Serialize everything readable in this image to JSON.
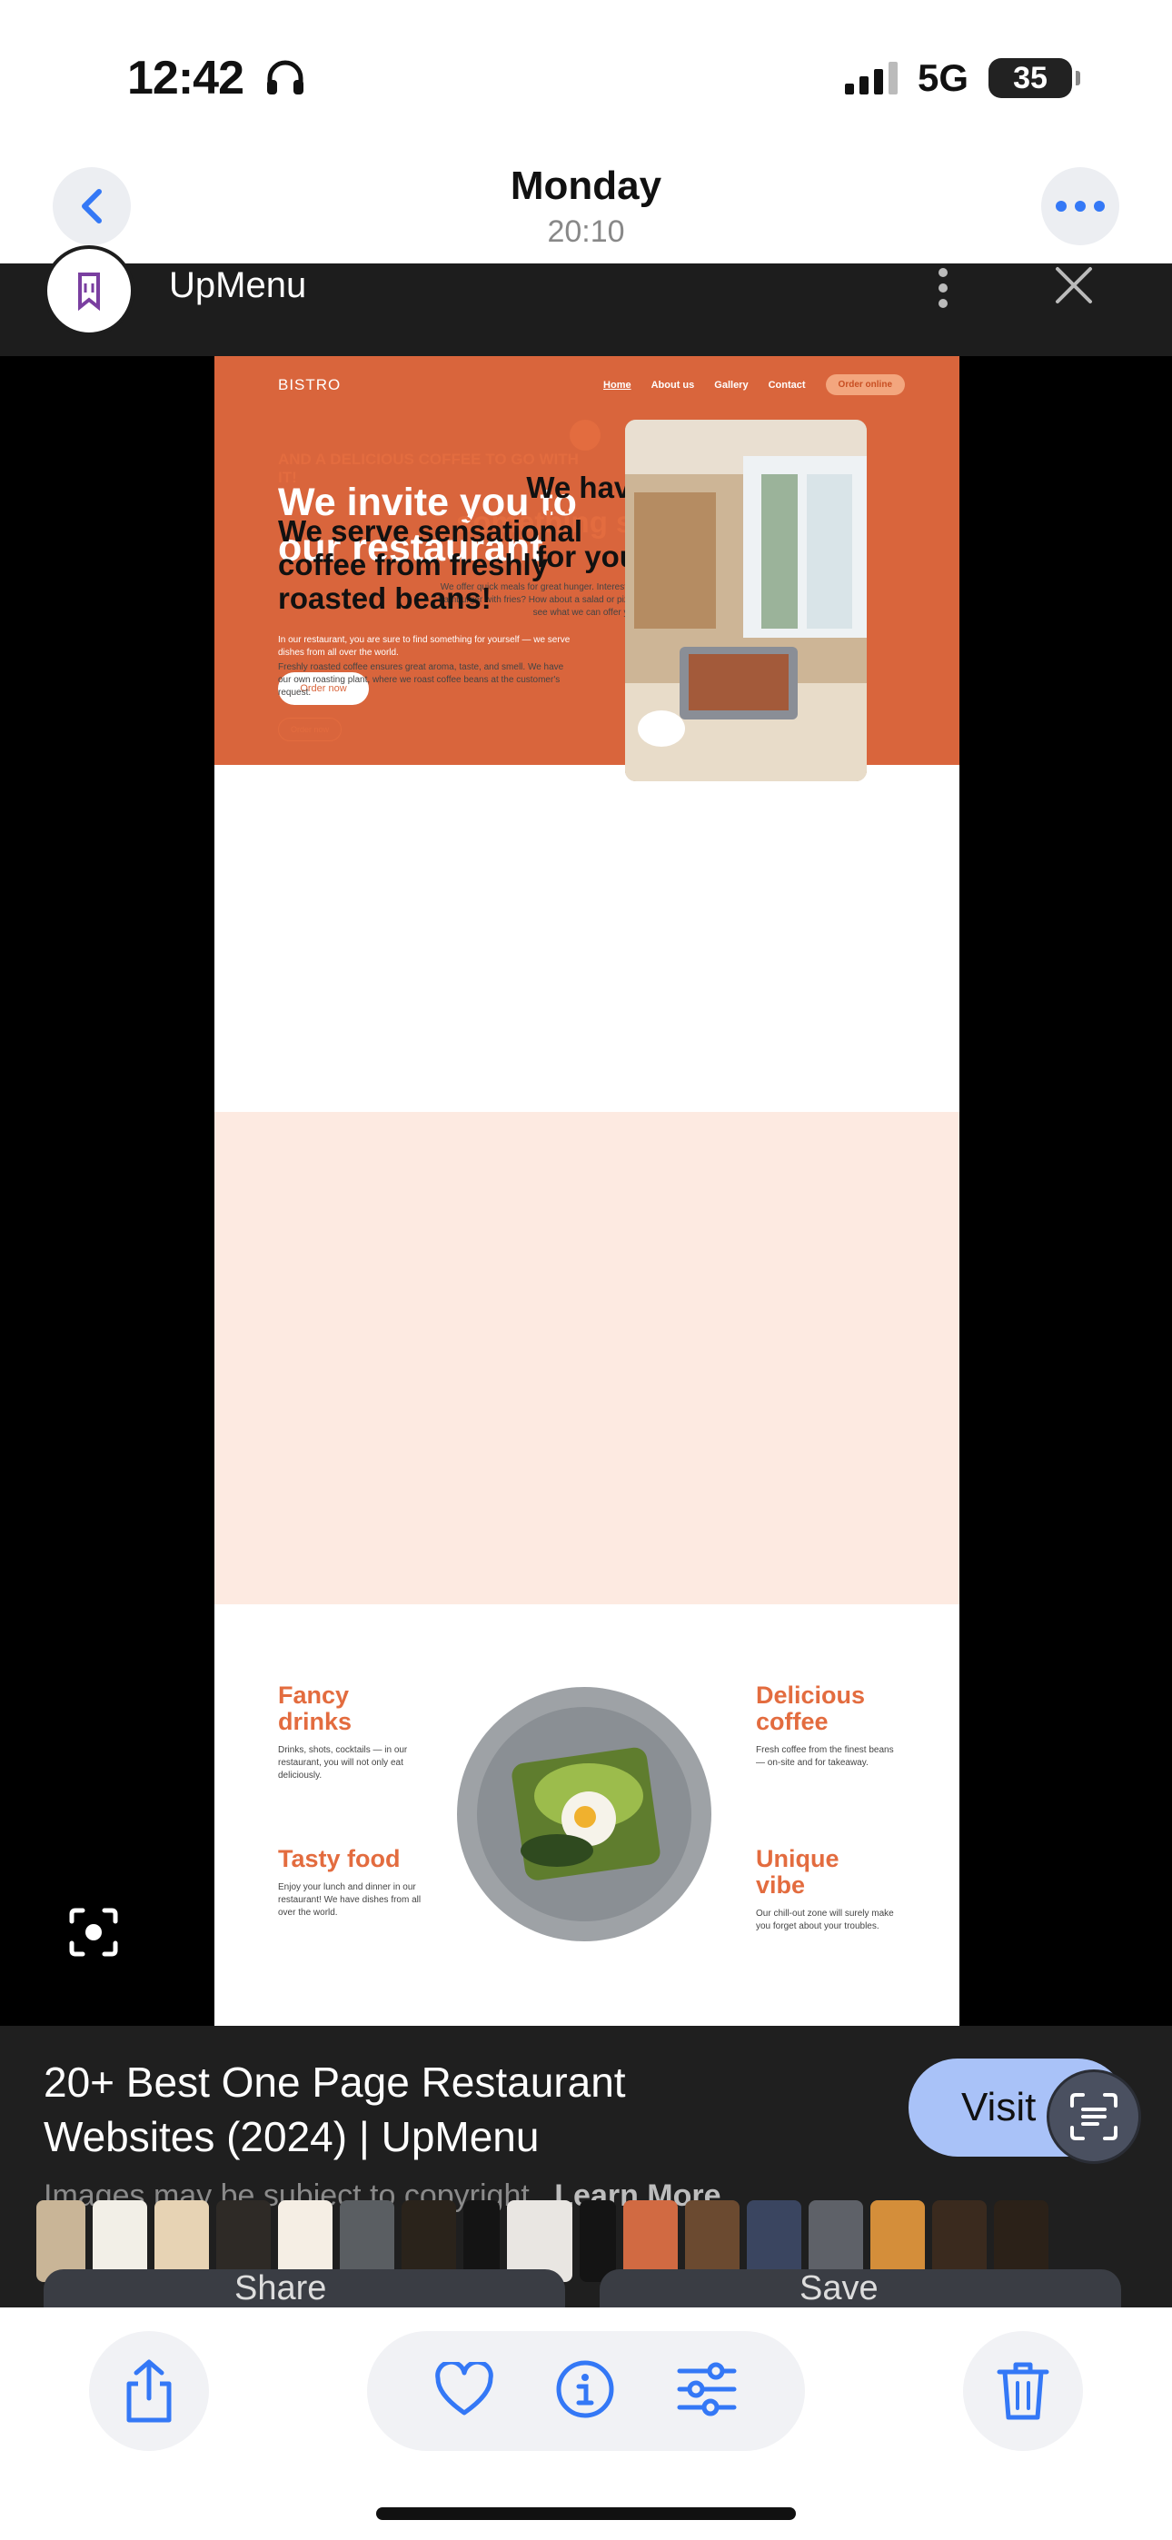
{
  "status_bar": {
    "time": "12:42",
    "network": "5G",
    "battery": "35"
  },
  "header": {
    "title": "Monday",
    "subtitle": "20:10"
  },
  "source": {
    "name": "UpMenu"
  },
  "website": {
    "logo": "BISTRO",
    "nav": [
      "Home",
      "About us",
      "Gallery",
      "Contact"
    ],
    "nav_cta": "Order online",
    "hero_title": "We invite you to our restaurant",
    "hero_text": "In our restaurant, you are sure to find something for yourself — we serve dishes from all over the world.",
    "hero_button": "Order now",
    "sec2_line1": "We have",
    "sec2_line2": "something special",
    "sec2_line3": "for you",
    "sec2_text": "We offer quick meals for great hunger. Interested? Are you dreaming of a hamburger with fries? How about a salad or pizza? Explore our menu and see what we can offer you.",
    "sec3_kicker": "AND A DELICIOUS COFFEE TO GO WITH IT!",
    "sec3_title": "We serve sensational coffee from freshly roasted beans!",
    "sec3_text": "Freshly roasted coffee ensures great aroma, taste, and smell. We have our own roasting plant, where we roast coffee beans at the customer's request.",
    "sec3_button": "Order now",
    "features": [
      {
        "title": "Fancy drinks",
        "text": "Drinks, shots, cocktails — in our restaurant, you will not only eat deliciously."
      },
      {
        "title": "Delicious coffee",
        "text": "Fresh coffee from the finest beans — on-site and for takeaway."
      },
      {
        "title": "Tasty food",
        "text": "Enjoy your lunch and dinner in our restaurant! We have dishes from all over the world."
      },
      {
        "title": "Unique vibe",
        "text": "Our chill-out zone will surely make you forget about your troubles."
      }
    ]
  },
  "caption": {
    "title": "20+ Best One Page Restaurant Websites (2024) | UpMenu",
    "legal": "Images may be subject to copyright.",
    "learn_more": "Learn More",
    "visit": "Visit"
  },
  "action_tabs": {
    "share": "Share",
    "save": "Save"
  },
  "icons": {
    "back": "chevron-left-icon",
    "more": "more-horizontal-icon",
    "close": "close-icon",
    "lens": "lens-icon",
    "share": "share-icon",
    "favorite": "heart-icon",
    "info": "info-icon",
    "adjust": "sliders-icon",
    "delete": "trash-icon"
  },
  "colors": {
    "accent": "#3478f6",
    "brand_orange": "#d9653c",
    "visit_bg": "#a9c2f8"
  }
}
